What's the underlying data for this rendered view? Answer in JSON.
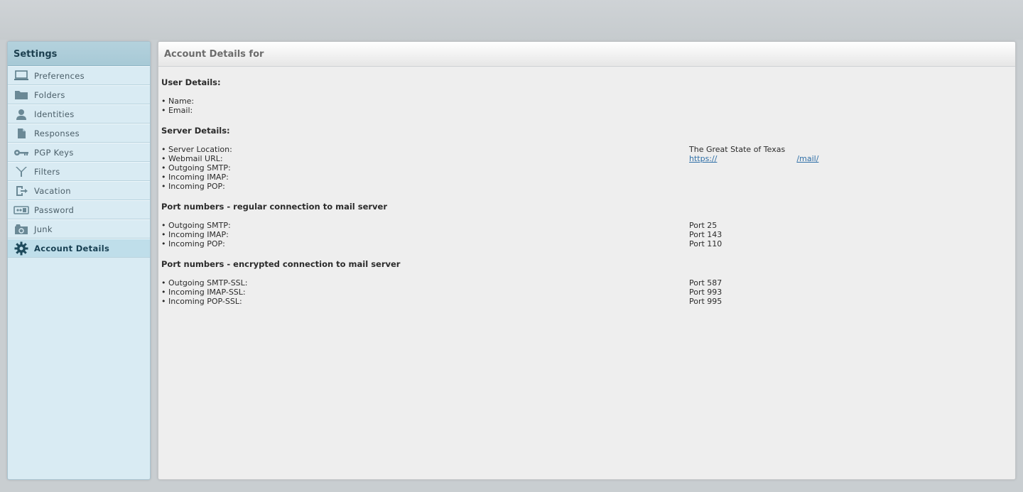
{
  "sidebar": {
    "title": "Settings",
    "items": [
      {
        "label": "Preferences",
        "icon": "monitor-icon"
      },
      {
        "label": "Folders",
        "icon": "folder-icon"
      },
      {
        "label": "Identities",
        "icon": "person-icon"
      },
      {
        "label": "Responses",
        "icon": "document-icon"
      },
      {
        "label": "PGP Keys",
        "icon": "key-icon"
      },
      {
        "label": "Filters",
        "icon": "filter-icon"
      },
      {
        "label": "Vacation",
        "icon": "exit-icon"
      },
      {
        "label": "Password",
        "icon": "password-icon"
      },
      {
        "label": "Junk",
        "icon": "junk-icon"
      },
      {
        "label": "Account Details",
        "icon": "gear-icon",
        "active": true
      }
    ]
  },
  "main": {
    "title": "Account Details for",
    "user_details": {
      "heading": "User Details:",
      "rows": [
        {
          "label": "• Name:",
          "value": ""
        },
        {
          "label": "• Email:",
          "value": ""
        }
      ]
    },
    "server_details": {
      "heading": "Server Details:",
      "rows": [
        {
          "label": "• Server Location:",
          "value": "The Great State of Texas"
        },
        {
          "label": "• Webmail URL:",
          "link_start": "https://",
          "link_end": "/mail/"
        },
        {
          "label": "• Outgoing SMTP:",
          "value": ""
        },
        {
          "label": "• Incoming IMAP:",
          "value": ""
        },
        {
          "label": "• Incoming POP:",
          "value": ""
        }
      ]
    },
    "regular_ports": {
      "heading": "Port numbers - regular connection to mail server",
      "rows": [
        {
          "label": "• Outgoing SMTP:",
          "value": "Port 25"
        },
        {
          "label": "• Incoming IMAP:",
          "value": "Port 143"
        },
        {
          "label": "• Incoming POP:",
          "value": "Port 110"
        }
      ]
    },
    "encrypted_ports": {
      "heading": "Port numbers - encrypted connection to mail server",
      "rows": [
        {
          "label": "• Outgoing SMTP-SSL:",
          "value": "Port 587"
        },
        {
          "label": "• Incoming IMAP-SSL:",
          "value": "Port 993"
        },
        {
          "label": "• Incoming POP-SSL:",
          "value": "Port 995"
        }
      ]
    }
  },
  "colors": {
    "accent": "#2f6fa7",
    "sidebar_bg": "#d9ebf3",
    "active_bg": "#bfdeea"
  }
}
